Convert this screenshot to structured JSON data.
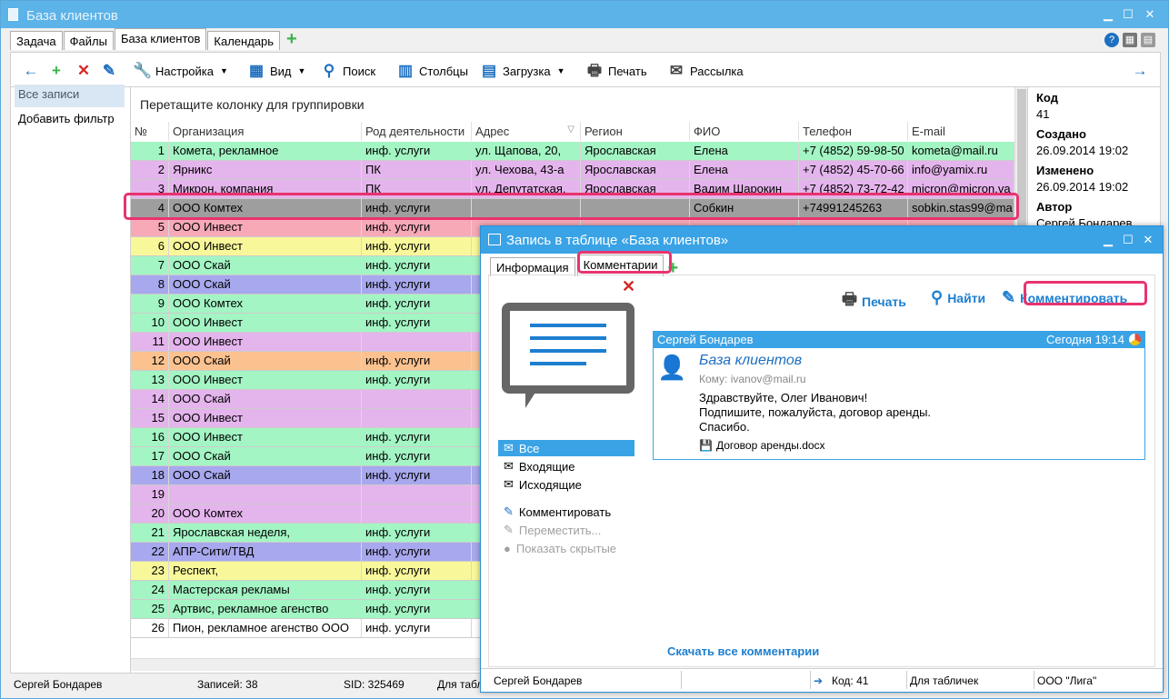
{
  "window": {
    "title": "База клиентов"
  },
  "tabs": [
    {
      "label": "Задача"
    },
    {
      "label": "Файлы"
    },
    {
      "label": "База клиентов"
    },
    {
      "label": "Календарь"
    }
  ],
  "toolbar": {
    "settings": "Настройка",
    "view": "Вид",
    "search": "Поиск",
    "columns": "Столбцы",
    "load": "Загрузка",
    "print": "Печать",
    "mailing": "Рассылка"
  },
  "left": {
    "all_records": "Все записи",
    "add_filter": "Добавить фильтр"
  },
  "grid": {
    "group_hint": "Перетащите колонку для группировки",
    "columns": [
      "№",
      "Организация",
      "Род деятельности",
      "Адрес",
      "Регион",
      "ФИО",
      "Телефон",
      "E-mail"
    ],
    "rows": [
      {
        "n": "1",
        "org": "Комета, рекламное",
        "kind": "инф. услуги",
        "addr": "ул. Щапова, 20,",
        "region": "Ярославская",
        "fio": "Елена",
        "phone": "+7 (4852) 59-98-50",
        "email": "kometa@mail.ru",
        "color": "#a3f5c4"
      },
      {
        "n": "2",
        "org": "Ярникс",
        "kind": "ПК",
        "addr": "ул. Чехова, 43-а",
        "region": "Ярославская",
        "fio": "Елена",
        "phone": "+7 (4852) 45-70-66",
        "email": "info@yamix.ru",
        "color": "#e4b4ec"
      },
      {
        "n": "3",
        "org": "Микрон, компания",
        "kind": "ПК",
        "addr": "ул. Депутатская,",
        "region": "Ярославская",
        "fio": "Вадим Шарокин",
        "phone": "+7 (4852) 73-72-42",
        "email": "micron@micron.va",
        "color": "#e4b4ec"
      },
      {
        "n": "4",
        "org": "ООО Комтех",
        "kind": "инф. услуги",
        "addr": "",
        "region": "",
        "fio": "Собкин",
        "phone": "+74991245263",
        "email": "sobkin.stas99@ma",
        "color": "#9e9e9e"
      },
      {
        "n": "5",
        "org": "ООО Инвест",
        "kind": "инф. услуги",
        "addr": "",
        "region": "",
        "fio": "",
        "phone": "",
        "email": "",
        "color": "#f7a9b8"
      },
      {
        "n": "6",
        "org": "ООО Инвест",
        "kind": "инф. услуги",
        "addr": "",
        "region": "",
        "fio": "",
        "phone": "",
        "email": "",
        "color": "#f8f89a"
      },
      {
        "n": "7",
        "org": "ООО Скай",
        "kind": "инф. услуги",
        "addr": "",
        "region": "",
        "fio": "",
        "phone": "",
        "email": "",
        "color": "#a3f5c4"
      },
      {
        "n": "8",
        "org": "ООО Скай",
        "kind": "инф. услуги",
        "addr": "",
        "region": "",
        "fio": "",
        "phone": "",
        "email": "",
        "color": "#a8a8ee"
      },
      {
        "n": "9",
        "org": "ООО Комтех",
        "kind": "инф. услуги",
        "addr": "",
        "region": "",
        "fio": "",
        "phone": "",
        "email": "",
        "color": "#a3f5c4"
      },
      {
        "n": "10",
        "org": "ООО Инвест",
        "kind": "инф. услуги",
        "addr": "",
        "region": "",
        "fio": "",
        "phone": "",
        "email": "",
        "color": "#a3f5c4"
      },
      {
        "n": "11",
        "org": "ООО Инвест",
        "kind": "",
        "addr": "",
        "region": "",
        "fio": "",
        "phone": "",
        "email": "",
        "color": "#e4b4ec"
      },
      {
        "n": "12",
        "org": "ООО Скай",
        "kind": "инф. услуги",
        "addr": "",
        "region": "",
        "fio": "",
        "phone": "",
        "email": "",
        "color": "#fbc28f"
      },
      {
        "n": "13",
        "org": "ООО Инвест",
        "kind": "инф. услуги",
        "addr": "",
        "region": "",
        "fio": "",
        "phone": "",
        "email": "",
        "color": "#a3f5c4"
      },
      {
        "n": "14",
        "org": "ООО Скай",
        "kind": "",
        "addr": "",
        "region": "",
        "fio": "",
        "phone": "",
        "email": "",
        "color": "#e4b4ec"
      },
      {
        "n": "15",
        "org": "ООО Инвест",
        "kind": "",
        "addr": "",
        "region": "",
        "fio": "",
        "phone": "",
        "email": "",
        "color": "#e4b4ec"
      },
      {
        "n": "16",
        "org": "ООО Инвест",
        "kind": "инф. услуги",
        "addr": "",
        "region": "",
        "fio": "",
        "phone": "",
        "email": "",
        "color": "#a3f5c4"
      },
      {
        "n": "17",
        "org": "ООО Скай",
        "kind": "инф. услуги",
        "addr": "",
        "region": "",
        "fio": "",
        "phone": "",
        "email": "",
        "color": "#a3f5c4"
      },
      {
        "n": "18",
        "org": "ООО Скай",
        "kind": "инф. услуги",
        "addr": "",
        "region": "",
        "fio": "",
        "phone": "",
        "email": "",
        "color": "#a8a8ee"
      },
      {
        "n": "19",
        "org": "",
        "kind": "",
        "addr": "",
        "region": "",
        "fio": "",
        "phone": "",
        "email": "",
        "color": "#e4b4ec"
      },
      {
        "n": "20",
        "org": "ООО Комтех",
        "kind": "",
        "addr": "",
        "region": "",
        "fio": "",
        "phone": "",
        "email": "",
        "color": "#e4b4ec"
      },
      {
        "n": "21",
        "org": "Ярославская неделя,",
        "kind": "инф. услуги",
        "addr": "",
        "region": "",
        "fio": "",
        "phone": "",
        "email": "",
        "color": "#a3f5c4"
      },
      {
        "n": "22",
        "org": "АПР-Сити/ТВД",
        "kind": "инф. услуги",
        "addr": "",
        "region": "",
        "fio": "",
        "phone": "",
        "email": "",
        "color": "#a8a8ee"
      },
      {
        "n": "23",
        "org": "Респект,",
        "kind": "инф. услуги",
        "addr": "",
        "region": "",
        "fio": "",
        "phone": "",
        "email": "",
        "color": "#f8f89a"
      },
      {
        "n": "24",
        "org": "Мастерская рекламы",
        "kind": "инф. услуги",
        "addr": "",
        "region": "",
        "fio": "",
        "phone": "",
        "email": "",
        "color": "#a3f5c4"
      },
      {
        "n": "25",
        "org": "Артвис, рекламное агенство",
        "kind": "инф. услуги",
        "addr": "",
        "region": "",
        "fio": "",
        "phone": "",
        "email": "",
        "color": "#a3f5c4"
      },
      {
        "n": "26",
        "org": "Пион, рекламное агенство ООО",
        "kind": "инф. услуги",
        "addr": "",
        "region": "",
        "fio": "",
        "phone": "",
        "email": "",
        "color": "#ffffff"
      }
    ]
  },
  "details": {
    "code_label": "Код",
    "code": "41",
    "created_label": "Создано",
    "created": "26.09.2014 19:02",
    "changed_label": "Изменено",
    "changed": "26.09.2014 19:02",
    "author_label": "Автор",
    "author": "Сергей Бондарев"
  },
  "status": {
    "user": "Сергей Бондарев",
    "records": "Записей: 38",
    "sid": "SID: 325469",
    "for": "Для табл"
  },
  "dialog": {
    "title": "Запись в таблице «База клиентов»",
    "tabs": [
      "Информация",
      "Комментарии"
    ],
    "actions": {
      "print": "Печать",
      "find": "Найти",
      "comment": "Комментировать"
    },
    "filters": {
      "all": "Все",
      "incoming": "Входящие",
      "outgoing": "Исходящие",
      "comment": "Комментировать",
      "move": "Переместить...",
      "show_hidden": "Показать скрытые"
    },
    "message": {
      "author": "Сергей Бондарев",
      "time": "Сегодня 19:14",
      "subject": "База клиентов",
      "to": "Кому: ivanov@mail.ru",
      "line1": "Здравствуйте, Олег Иванович!",
      "line2": "Подпишите, пожалуйста, договор аренды.",
      "line3": "Спасибо.",
      "attachment": "Договор аренды.docx"
    },
    "download_all": "Скачать все комментарии",
    "status": {
      "user": "Сергей Бондарев",
      "code": "Код: 41",
      "for": "Для табличек",
      "org": "ООО \"Лига\""
    }
  },
  "colors": {
    "accent": "#3aa3e6",
    "highlight": "#e8336f"
  }
}
